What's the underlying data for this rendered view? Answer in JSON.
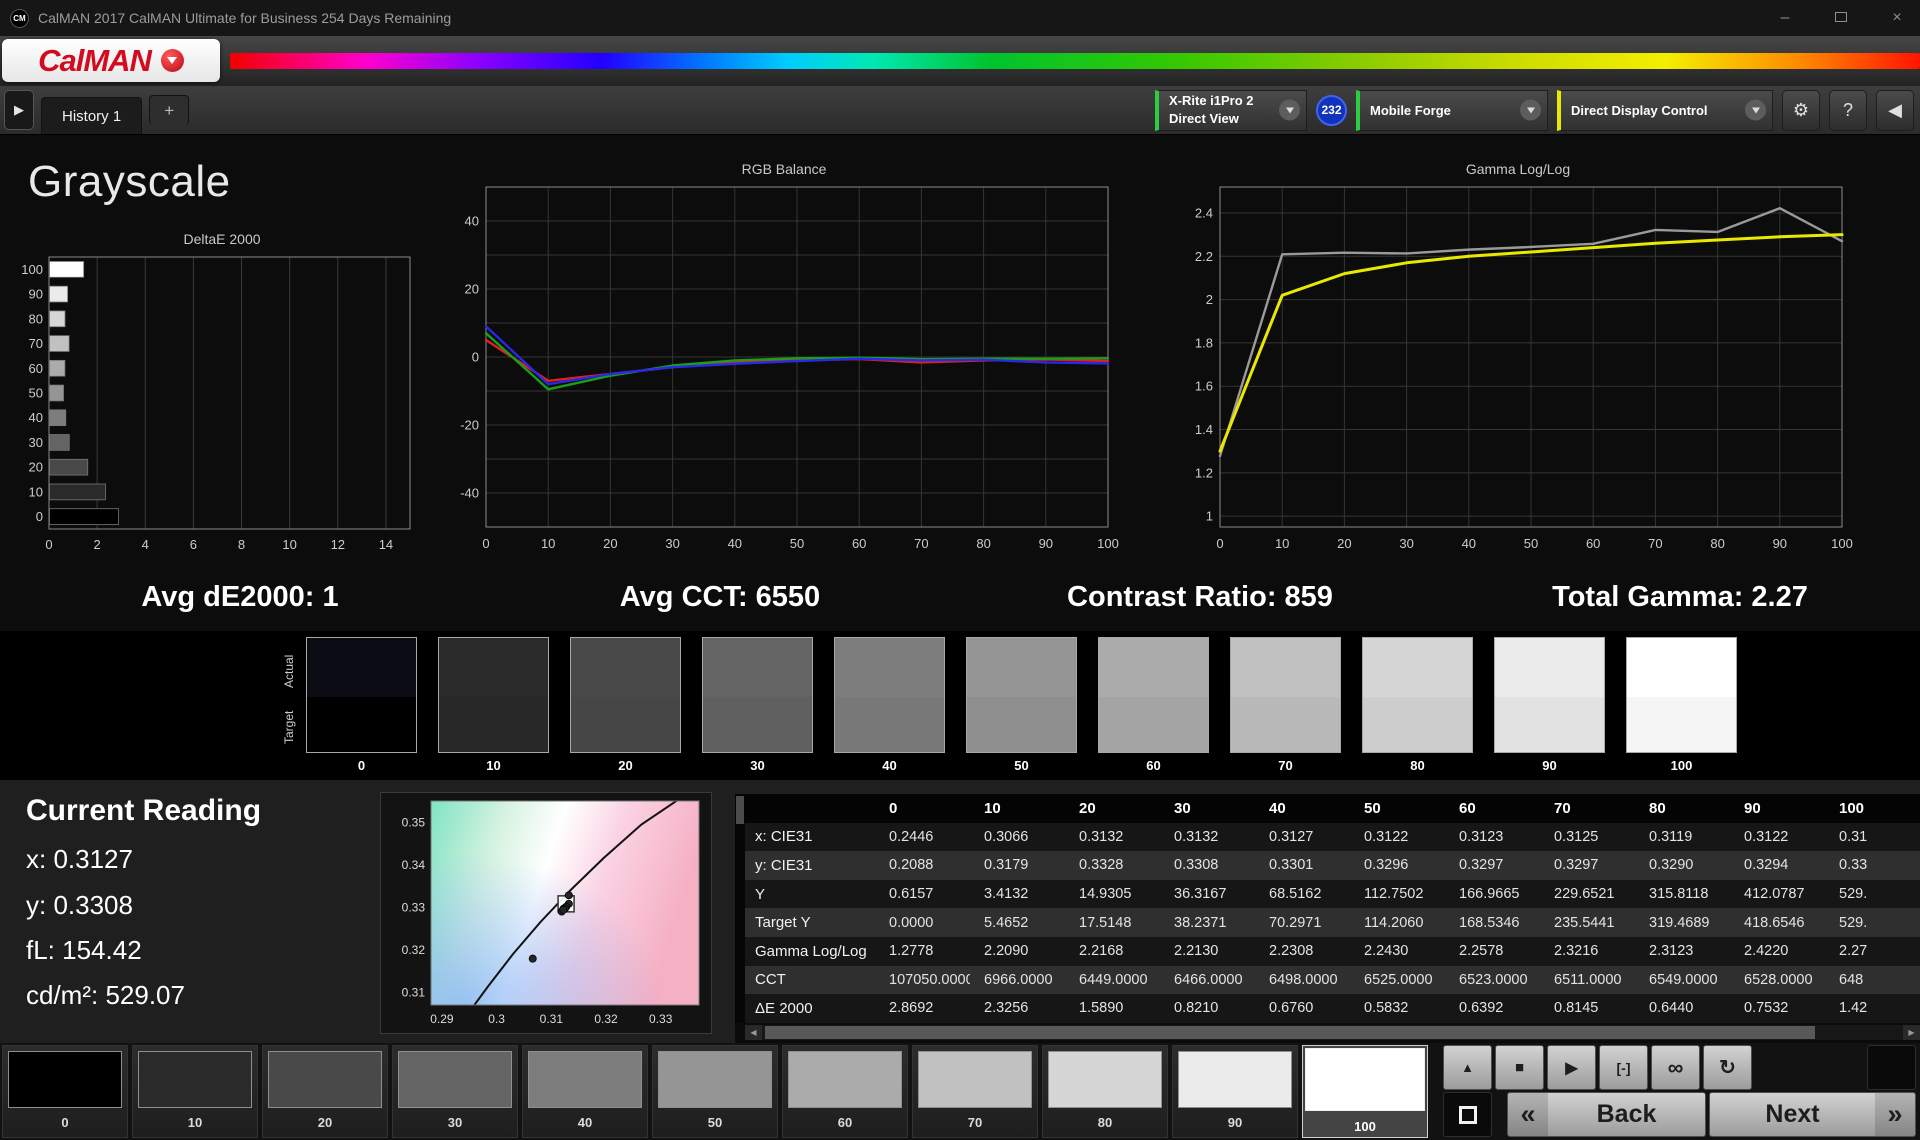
{
  "window": {
    "title": "CalMAN 2017 CalMAN Ultimate for Business 254 Days Remaining"
  },
  "brand": {
    "logo_text": "CalMAN"
  },
  "toolbar": {
    "history_tab": "History 1",
    "add_tab": "+",
    "meter": {
      "line1": "X-Rite i1Pro 2",
      "line2": "Direct View",
      "badge": "232"
    },
    "source_label": "Mobile Forge",
    "display_control_label": "Direct Display Control"
  },
  "page": {
    "title": "Grayscale"
  },
  "stats": [
    "Avg dE2000: 1",
    "Avg CCT: 6550",
    "Contrast Ratio: 859",
    "Total Gamma: 2.27"
  ],
  "swatches": {
    "row_labels": [
      "Actual",
      "Target"
    ],
    "levels": [
      0,
      10,
      20,
      30,
      40,
      50,
      60,
      70,
      80,
      90,
      100
    ]
  },
  "current_reading": {
    "title": "Current Reading",
    "lines": [
      "x: 0.3127",
      "y: 0.3308",
      "fL: 154.42",
      "cd/m²: 529.07"
    ]
  },
  "table": {
    "columns": [
      "0",
      "10",
      "20",
      "30",
      "40",
      "50",
      "60",
      "70",
      "80",
      "90",
      "100"
    ],
    "rows": [
      {
        "label": "x: CIE31",
        "values": [
          "0.2446",
          "0.3066",
          "0.3132",
          "0.3132",
          "0.3127",
          "0.3122",
          "0.3123",
          "0.3125",
          "0.3119",
          "0.3122",
          "0.31"
        ]
      },
      {
        "label": "y: CIE31",
        "values": [
          "0.2088",
          "0.3179",
          "0.3328",
          "0.3308",
          "0.3301",
          "0.3296",
          "0.3297",
          "0.3297",
          "0.3290",
          "0.3294",
          "0.33"
        ]
      },
      {
        "label": "Y",
        "values": [
          "0.6157",
          "3.4132",
          "14.9305",
          "36.3167",
          "68.5162",
          "112.7502",
          "166.9665",
          "229.6521",
          "315.8118",
          "412.0787",
          "529."
        ]
      },
      {
        "label": "Target Y",
        "values": [
          "0.0000",
          "5.4652",
          "17.5148",
          "38.2371",
          "70.2971",
          "114.2060",
          "168.5346",
          "235.5441",
          "319.4689",
          "418.6546",
          "529."
        ]
      },
      {
        "label": "Gamma Log/Log",
        "values": [
          "1.2778",
          "2.2090",
          "2.2168",
          "2.2130",
          "2.2308",
          "2.2430",
          "2.2578",
          "2.3216",
          "2.3123",
          "2.4220",
          "2.27"
        ]
      },
      {
        "label": "CCT",
        "values": [
          "107050.0000",
          "6966.0000",
          "6449.0000",
          "6466.0000",
          "6498.0000",
          "6525.0000",
          "6523.0000",
          "6511.0000",
          "6549.0000",
          "6528.0000",
          "648"
        ]
      },
      {
        "label": "ΔE 2000",
        "values": [
          "2.8692",
          "2.3256",
          "1.5890",
          "0.8210",
          "0.6760",
          "0.5832",
          "0.6392",
          "0.8145",
          "0.6440",
          "0.7532",
          "1.42"
        ]
      }
    ]
  },
  "patchbar": {
    "levels": [
      0,
      10,
      20,
      30,
      40,
      50,
      60,
      70,
      80,
      90,
      100
    ],
    "selected": 100
  },
  "transport": {
    "back_label": "Back",
    "next_label": "Next"
  },
  "icons": {
    "minimize": "–",
    "close": "×",
    "panel_expand": "▶",
    "panel_collapse": "◀",
    "settings": "⚙",
    "help": "?",
    "stop": "■",
    "play": "▶",
    "pattern_window": "[-]",
    "continuous": "∞",
    "loop": "↻",
    "chevron_up": "▲",
    "back_chevron": "«",
    "next_chevron": "»",
    "scroll_left": "◀",
    "scroll_right": "▶"
  },
  "colors": {
    "accent_red": "#d40a1e",
    "meter_status_green": "#2ecc40",
    "display_status_yellow": "#e8e800",
    "badge_blue": "#1133bb"
  },
  "chart_data": [
    {
      "id": "deltae",
      "type": "bar",
      "title": "DeltaE 2000",
      "orientation": "horizontal",
      "categories": [
        100,
        90,
        80,
        70,
        60,
        50,
        40,
        30,
        20,
        10,
        0
      ],
      "values": [
        1.42,
        0.7532,
        0.644,
        0.8145,
        0.6392,
        0.5832,
        0.676,
        0.821,
        1.589,
        2.3256,
        2.8692
      ],
      "xlim": [
        0,
        15
      ],
      "xticks": [
        0,
        2,
        4,
        6,
        8,
        10,
        12,
        14
      ],
      "grid": true
    },
    {
      "id": "rgb_balance",
      "type": "line",
      "title": "RGB Balance",
      "x": [
        0,
        10,
        20,
        30,
        40,
        50,
        60,
        70,
        80,
        90,
        100
      ],
      "ylim": [
        -50,
        50
      ],
      "yticks": [
        40,
        20,
        0,
        -20,
        -40
      ],
      "grid_y": [
        -40,
        -30,
        -20,
        -10,
        0,
        10,
        20,
        30,
        40
      ],
      "series": [
        {
          "name": "Red",
          "color": "#e02020",
          "values": [
            5,
            -7,
            -5,
            -3,
            -1.5,
            -1,
            -0.6,
            -1.6,
            -1,
            -0.7,
            -1.2
          ]
        },
        {
          "name": "Green",
          "color": "#18a018",
          "values": [
            7,
            -9.5,
            -5.5,
            -2.5,
            -1,
            -0.4,
            -0.2,
            -0.6,
            -0.5,
            -0.5,
            -0.4
          ]
        },
        {
          "name": "Blue",
          "color": "#2828e8",
          "values": [
            9,
            -8,
            -5,
            -3,
            -2,
            -1.2,
            -0.5,
            -1,
            -0.8,
            -1.6,
            -1.9
          ]
        }
      ]
    },
    {
      "id": "gamma",
      "type": "line",
      "title": "Gamma Log/Log",
      "x": [
        0,
        10,
        20,
        30,
        40,
        50,
        60,
        70,
        80,
        90,
        100
      ],
      "ylim": [
        0.95,
        2.52
      ],
      "yticks": [
        2.4,
        2.2,
        2,
        1.8,
        1.6,
        1.4,
        1.2,
        1
      ],
      "grid_y": [
        1,
        1.2,
        1.4,
        1.6,
        1.8,
        2,
        2.2,
        2.4
      ],
      "series": [
        {
          "name": "Measured",
          "color": "#9a9a9a",
          "values": [
            1.2778,
            2.209,
            2.2168,
            2.213,
            2.2308,
            2.243,
            2.2578,
            2.3216,
            2.3123,
            2.422,
            2.27
          ]
        },
        {
          "name": "Target",
          "color": "#e8e800",
          "values": [
            1.3,
            2.02,
            2.12,
            2.17,
            2.2,
            2.22,
            2.24,
            2.26,
            2.275,
            2.29,
            2.3
          ]
        }
      ]
    },
    {
      "id": "cie",
      "type": "scatter",
      "xlim": [
        0.288,
        0.337
      ],
      "ylim": [
        0.307,
        0.355
      ],
      "xticks": [
        0.29,
        0.3,
        0.31,
        0.32,
        0.33
      ],
      "yticks": [
        0.35,
        0.34,
        0.33,
        0.32,
        0.31
      ],
      "locus": [
        [
          0.2945,
          0.3045
        ],
        [
          0.2985,
          0.3115
        ],
        [
          0.303,
          0.319
        ],
        [
          0.308,
          0.3265
        ],
        [
          0.3135,
          0.334
        ],
        [
          0.3195,
          0.3415
        ],
        [
          0.3265,
          0.3495
        ],
        [
          0.334,
          0.356
        ]
      ],
      "points": [
        [
          0.3066,
          0.3179
        ],
        [
          0.3132,
          0.3328
        ],
        [
          0.3132,
          0.3308
        ],
        [
          0.3127,
          0.3301
        ],
        [
          0.3122,
          0.3296
        ],
        [
          0.3123,
          0.3297
        ],
        [
          0.3125,
          0.3297
        ],
        [
          0.3119,
          0.329
        ],
        [
          0.3122,
          0.3294
        ]
      ],
      "target": [
        0.3127,
        0.3308
      ]
    }
  ]
}
